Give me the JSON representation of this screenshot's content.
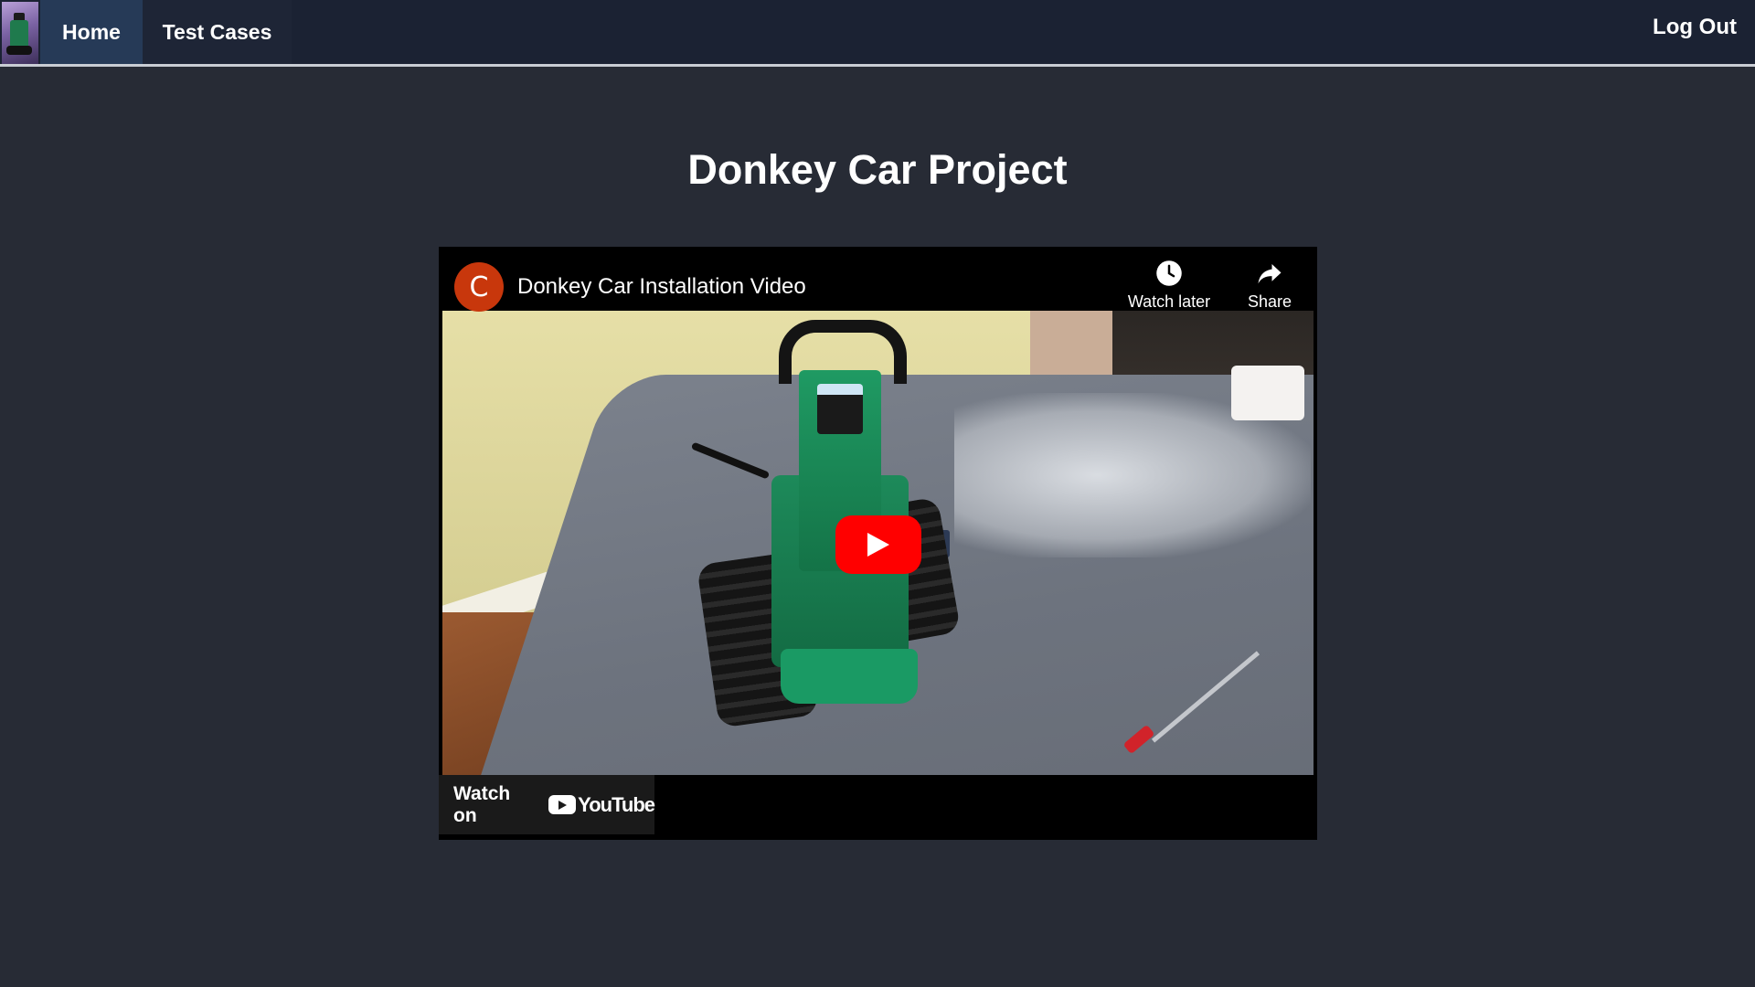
{
  "nav": {
    "tabs": [
      {
        "label": "Home"
      },
      {
        "label": "Test Cases"
      }
    ],
    "logout_label": "Log Out"
  },
  "page": {
    "title": "Donkey Car Project"
  },
  "video": {
    "channel_initial": "C",
    "title": "Donkey Car Installation Video",
    "watch_later_label": "Watch later",
    "share_label": "Share",
    "watch_on_label": "Watch on",
    "youtube_wordmark": "YouTube"
  },
  "colors": {
    "page_background": "#272b35",
    "navbar_background": "#1b2233",
    "home_tab_active": "#263a57",
    "play_button": "#ff0000",
    "channel_avatar": "#c8370c"
  }
}
